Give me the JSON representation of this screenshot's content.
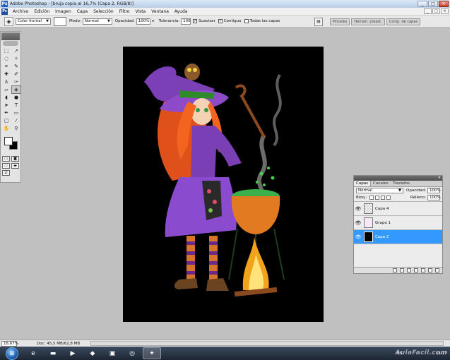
{
  "window": {
    "title": "Adobe Photoshop - [bruja copia al 16,7% (Capa 2, RGB/8)]",
    "app_icon": "Ps",
    "buttons": [
      "_",
      "□",
      "✕"
    ]
  },
  "menu": [
    "Archivo",
    "Edición",
    "Imagen",
    "Capa",
    "Selección",
    "Filtro",
    "Vista",
    "Ventana",
    "Ayuda"
  ],
  "options": {
    "sample_mode": "Color frontal",
    "mode_label": "Modo:",
    "mode_value": "Normal",
    "opacity_label": "Opacidad:",
    "opacity_value": "100%",
    "tolerance_label": "Tolerancia:",
    "tolerance_value": "100",
    "smooth_label": "Suavizar",
    "contiguous_label": "Contiguo",
    "all_layers_label": "Todas las capas",
    "dock_tabs": [
      "Pinceles",
      "Herram. preest.",
      "Comp. de capas"
    ]
  },
  "layers_panel": {
    "tabs": [
      "Capas",
      "Canales",
      "Trazados"
    ],
    "blend_mode": "Normal",
    "opacity_label": "Opacidad:",
    "opacity_value": "100%",
    "lock_label": "Bloq.:",
    "fill_label": "Relleno:",
    "fill_value": "100%",
    "layers": [
      {
        "name": "Capa 4",
        "visible": true,
        "selected": false,
        "thumb": "transparent"
      },
      {
        "name": "Grupo 1",
        "visible": true,
        "selected": false,
        "thumb": "group"
      },
      {
        "name": "Capa 2",
        "visible": true,
        "selected": true,
        "thumb": "black"
      }
    ]
  },
  "status": {
    "zoom": "16,67%",
    "doc": "Doc: 45,5 MB/62,8 MB"
  },
  "taskbar": {
    "language": "ES",
    "time": "11:27",
    "watermark": "AulaFacil.com"
  },
  "colors": {
    "foreground": "#ffffff",
    "background": "#000000",
    "selection": "#3399ff"
  }
}
